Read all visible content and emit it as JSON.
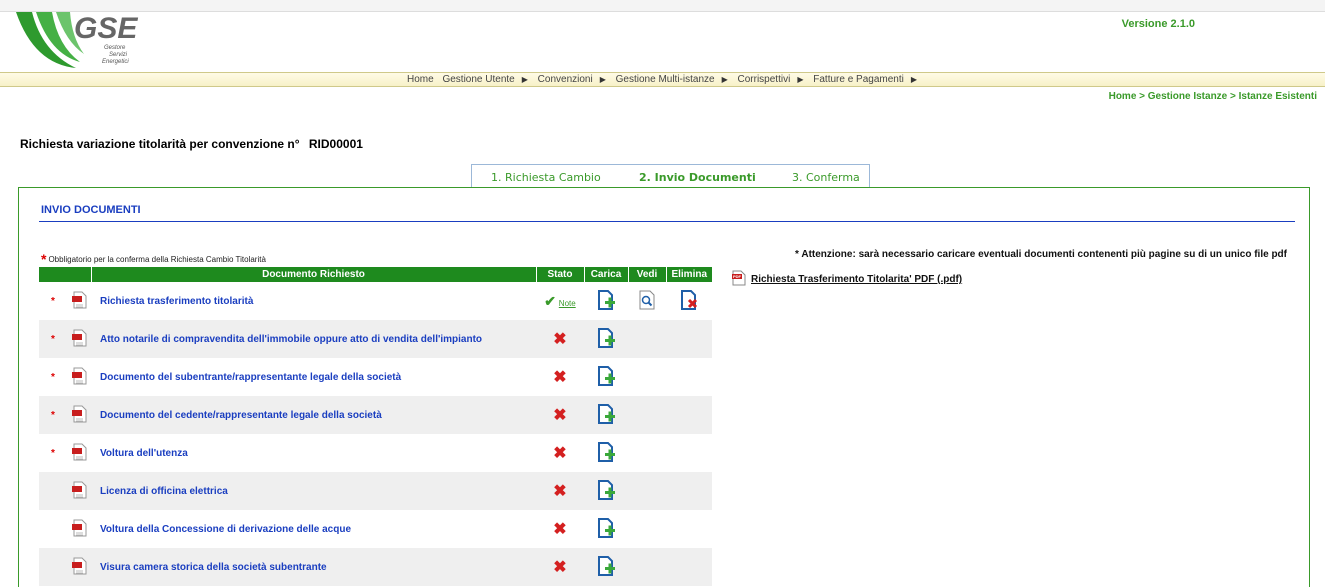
{
  "header": {
    "logo_text": "GSE",
    "logo_sub": [
      "Gestore",
      "Servizi",
      "Energetici"
    ],
    "version": "Versione 2.1.0"
  },
  "nav": {
    "items": [
      "Home",
      "Gestione Utente",
      "Convenzioni",
      "Gestione Multi-istanze",
      "Corrispettivi",
      "Fatture e Pagamenti"
    ]
  },
  "breadcrumb": "Home > Gestione Istanze > Istanze Esistenti",
  "page": {
    "title": "Richiesta variazione titolarità per convenzione n°",
    "code": "RID00001"
  },
  "steps": [
    "1. Richiesta Cambio",
    "2. Invio Documenti",
    "3. Conferma"
  ],
  "panel": {
    "title": "INVIO DOCUMENTI",
    "required_note": "Obbligatorio per la conferma della Richiesta Cambio Titolarità",
    "attention": "* Attenzione: sarà necessario caricare eventuali documenti contenenti più pagine su di un unico file pdf",
    "pdf_link": "Richiesta Trasferimento Titolarita' PDF (.pdf)"
  },
  "table": {
    "headers": [
      "Documento Richiesto",
      "Stato",
      "Carica",
      "Vedi",
      "Elimina"
    ],
    "note_label": "Note",
    "rows": [
      {
        "name": "Richiesta trasferimento titolarità",
        "required": true,
        "uploaded": true
      },
      {
        "name": "Atto notarile di compravendita dell'immobile oppure atto di vendita dell'impianto",
        "required": true,
        "uploaded": false
      },
      {
        "name": "Documento del subentrante/rappresentante legale della società",
        "required": true,
        "uploaded": false
      },
      {
        "name": "Documento del cedente/rappresentante legale della società",
        "required": true,
        "uploaded": false
      },
      {
        "name": "Voltura dell'utenza",
        "required": true,
        "uploaded": false
      },
      {
        "name": "Licenza di officina elettrica",
        "required": false,
        "uploaded": false
      },
      {
        "name": "Voltura della Concessione di derivazione delle acque",
        "required": false,
        "uploaded": false
      },
      {
        "name": "Visura camera storica della società subentrante",
        "required": false,
        "uploaded": false
      }
    ]
  },
  "colors": {
    "green": "#3a9a2a",
    "header_green": "#1e8a1e",
    "blue": "#1a3ec0",
    "red": "#d00000"
  }
}
